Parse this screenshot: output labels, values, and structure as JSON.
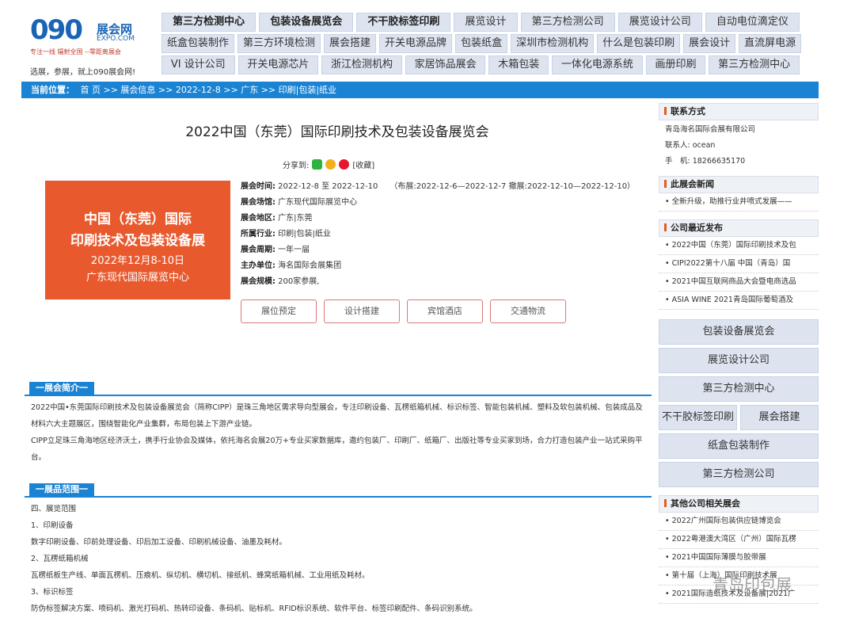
{
  "logo": {
    "num": "090",
    "name": "展会网",
    "sub": "EXPO.COM",
    "slogan": "专注一线 辐射全国 --零距离展会",
    "tagline": "选展，参展，就上090展会网!"
  },
  "nav": [
    [
      "第三方检测中心",
      "包装设备展览会",
      "不干胶标签印刷",
      "展览设计",
      "第三方检测公司",
      "展览设计公司",
      "自动电位滴定仪"
    ],
    [
      "纸盒包装制作",
      "第三方环境检测",
      "展会搭建",
      "开关电源品牌",
      "包装纸盒",
      "深圳市检测机构",
      "什么是包装印刷",
      "展会设计",
      "直流屏电源"
    ],
    [
      "VI 设计公司",
      "开关电源芯片",
      "浙江检测机构",
      "家居饰品展会",
      "木箱包装",
      "一体化电源系统",
      "画册印刷",
      "第三方检测中心"
    ]
  ],
  "breadcrumb": {
    "label": "当前位置：",
    "path": "首 页 >> 展会信息 >> 2022-12-8 >> 广东 >> 印刷|包装|纸业"
  },
  "expo": {
    "title": "2022中国（东莞）国际印刷技术及包装设备展览会",
    "share_label": "分享到:",
    "collect": "[收藏]",
    "banner": {
      "line1": "中国（东莞）国际",
      "line2": "印刷技术及包装设备展",
      "line3": "2022年12月8-10日",
      "line4": "广东现代国际展览中心"
    },
    "rows": [
      {
        "k": "展会时间:",
        "v": "2022-12-8 至 2022-12-10　　（布展:2022-12-6—2022-12-7 撤展:2022-12-10—2022-12-10）"
      },
      {
        "k": "展会场馆:",
        "v": "广东现代国际展览中心"
      },
      {
        "k": "展会地区:",
        "v": "广东|东莞"
      },
      {
        "k": "所属行业:",
        "v": "印刷|包装|纸业"
      },
      {
        "k": "展会周期:",
        "v": "一年一届"
      },
      {
        "k": "主办单位:",
        "v": "海名国际会展集团"
      },
      {
        "k": "展会规模:",
        "v": "200家参展,"
      }
    ],
    "buttons": [
      "展位预定",
      "设计搭建",
      "宾馆酒店",
      "交通物流"
    ]
  },
  "intro": {
    "title": "一展会简介一",
    "p1": "2022中国•东莞国际印刷技术及包装设备展览会（简称CIPP）是珠三角地区需求导向型展会，专注印刷设备、瓦楞纸箱机械、标识标签、智能包装机械、塑料及软包装机械、包装成品及材料六大主题展区，围绕智能化产业集群，布局包装上下游产业链。",
    "p2": "CIPP立足珠三角海地区经济沃土，携手行业协会及媒体，依托海名会展20万+专业买家数据库，邀约包装厂、印刷厂、纸箱厂、出版社等专业买家到场，合力打造包装产业一站式采购平台。"
  },
  "scope": {
    "title": "一展品范围一",
    "lines": [
      "四、展览范围",
      "1、印刷设备",
      "数字印刷设备、印前处理设备、印后加工设备、印刷机械设备、油墨及耗材。",
      "2、瓦楞纸箱机械",
      "瓦楞纸板生产线、单面瓦楞机、压痕机、纵切机、横切机、接纸机、蜂窝纸箱机械、工业用纸及耗材。",
      "3、标识标签",
      "防伪标签解决方案、喷码机、激光打码机、热转印设备、条码机、贴标机、RFID标识系统、软件平台、标签印刷配件、条码识别系统。"
    ]
  },
  "sidebar": {
    "contact_title": "联系方式",
    "contact": [
      "青岛海名国际会展有限公司",
      "联系人: ocean",
      "手　机: 18266635170"
    ],
    "news_title": "此展会新闻",
    "news": [
      "全新升级，助推行业井喷式发展——"
    ],
    "recent_title": "公司最近发布",
    "recent": [
      "2022中国（东莞）国际印刷技术及包",
      "CIPI2022第十八届 中国（青岛）国",
      "2021中国互联网商品大会暨电商选品",
      "ASIA WINE 2021青岛国际葡萄酒及"
    ],
    "links": [
      "包装设备展览会",
      "展览设计公司",
      "第三方检测中心"
    ],
    "links_half": [
      "不干胶标签印刷",
      "展会搭建"
    ],
    "links2": [
      "纸盒包装制作",
      "第三方检测公司"
    ],
    "other_title": "其他公司相关展会",
    "other": [
      "2022广州国际包装供应链博览会",
      "2022粤港澳大湾区（广州）国际瓦楞",
      "2021中国国际薄膜与胶带展",
      "第十届（上海）国际印刷技术展",
      "2021国际造纸技术及设备展|2021广"
    ]
  },
  "watermark": "青岛印包展"
}
